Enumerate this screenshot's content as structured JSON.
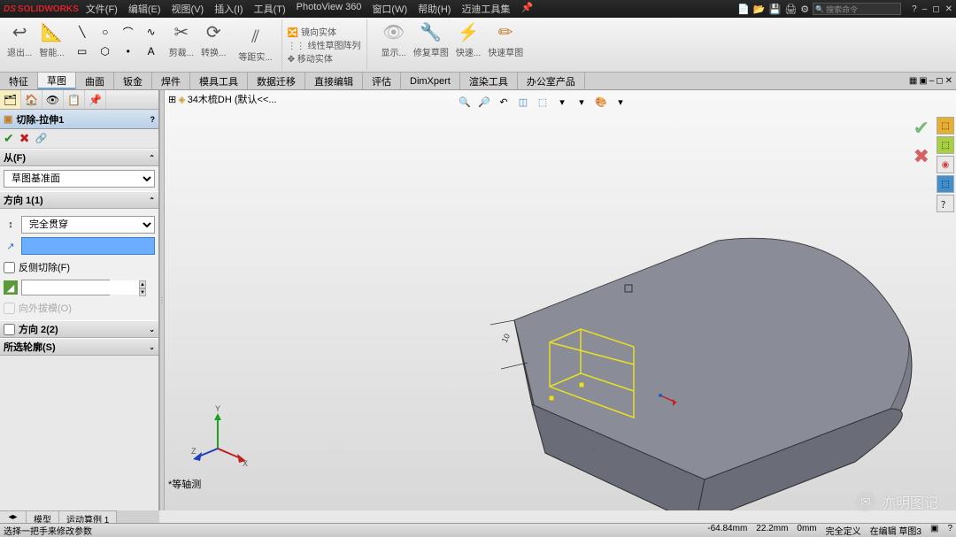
{
  "app": {
    "name": "SOLIDWORKS"
  },
  "menu": [
    "文件(F)",
    "编辑(E)",
    "视图(V)",
    "插入(I)",
    "工具(T)",
    "PhotoView 360",
    "窗口(W)",
    "帮助(H)",
    "迈迪工具集"
  ],
  "search": {
    "placeholder": "搜索命令"
  },
  "ribbon": {
    "exit": "退出...",
    "smart": "智能...",
    "trim": "剪裁...",
    "convert": "转换...",
    "offset": "等距实...",
    "mirror": "镜向实体",
    "pattern": "线性草图阵列",
    "move": "移动实体",
    "display": "显示...",
    "repair": "修复草图",
    "quick": "快速...",
    "rapid": "快速草图"
  },
  "tabs": [
    "特征",
    "草图",
    "曲面",
    "钣金",
    "焊件",
    "模具工具",
    "数据迁移",
    "直接编辑",
    "评估",
    "DimXpert",
    "渲染工具",
    "办公室产品"
  ],
  "activeTab": "草图",
  "doc": {
    "title": "34木梳DH  (默认<<..."
  },
  "feature": {
    "title": "切除-拉伸1",
    "from": {
      "label": "从(F)",
      "value": "草图基准面"
    },
    "dir1": {
      "label": "方向 1(1)",
      "condition": "完全贯穿",
      "reverse": "反侧切除(F)",
      "draft": "向外拔模(O)"
    },
    "dir2": {
      "label": "方向 2(2)"
    },
    "contours": {
      "label": "所选轮廓(S)"
    }
  },
  "view": {
    "label": "*等轴测"
  },
  "bottomTabs": [
    "模型",
    "运动算例 1"
  ],
  "status": {
    "hint": "选择一把手来修改参数",
    "x": "-64.84mm",
    "y": "22.2mm",
    "z": "0mm",
    "def": "完全定义",
    "edit": "在编辑 草图3"
  },
  "watermark": "亦明图记"
}
